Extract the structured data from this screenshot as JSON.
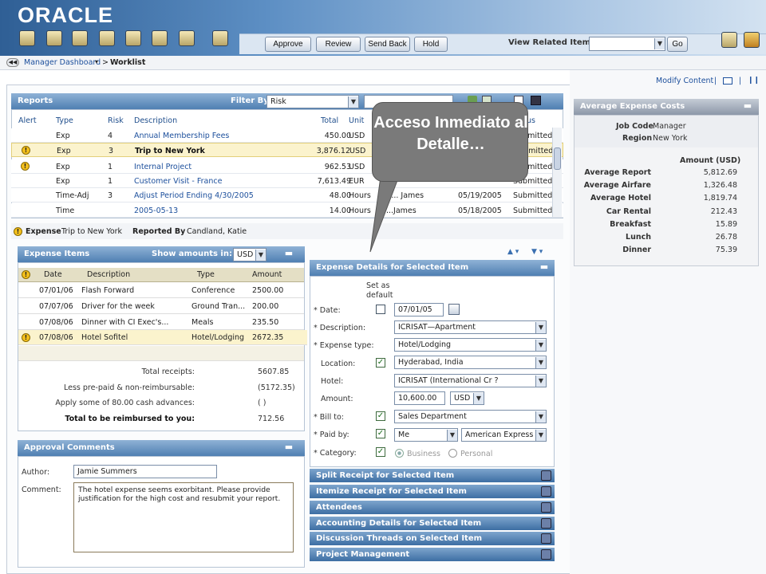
{
  "app": {
    "logo_text": "ORACLE"
  },
  "toolbar": {
    "icons": [
      "reports-icon",
      "search-icon",
      "expense-icon",
      "document-icon",
      "attach-icon",
      "user-icon",
      "chat-icon",
      "folder-icon"
    ],
    "approve_label": "Approve",
    "review_label": "Review",
    "sendback_label": "Send Back",
    "hold_label": "Hold",
    "view_related_label": "View Related Items",
    "view_related_value": "",
    "go_label": "Go",
    "right_icons": [
      "home-icon",
      "edit-icon"
    ]
  },
  "breadcrumb": {
    "dashboard": "Manager Dashboard",
    "separator": ">",
    "current": "Worklist"
  },
  "top_links": {
    "modify_content": "Modify Content",
    "sep": "|"
  },
  "reports": {
    "title": "Reports",
    "filter_label": "Filter By",
    "filter_value": "Risk",
    "columns": [
      "Alert",
      "Type",
      "Risk",
      "Description",
      "Total",
      "Unit",
      "",
      "",
      "us"
    ],
    "rows": [
      {
        "alert": false,
        "type": "Exp",
        "risk": "4",
        "description": "Annual Membership Fees",
        "total": "450.00",
        "unit": "USD",
        "submitter": "",
        "date": "",
        "status": "Submitted",
        "bold": false
      },
      {
        "alert": true,
        "type": "Exp",
        "risk": "3",
        "description": "Trip to New York",
        "total": "3,876.12",
        "unit": "USD",
        "submitter": "",
        "date": "",
        "status": "Submitted",
        "bold": true
      },
      {
        "alert": true,
        "type": "Exp",
        "risk": "1",
        "description": "Internal Project",
        "total": "962.53",
        "unit": "USD",
        "submitter": "",
        "date": "",
        "status": "Submitted",
        "bold": false
      },
      {
        "alert": false,
        "type": "Exp",
        "risk": "1",
        "description": "Customer Visit - France",
        "total": "7,613.49",
        "unit": "EUR",
        "submitter": "",
        "date": "",
        "status": "Submitted",
        "bold": false
      },
      {
        "alert": false,
        "type": "Time-Adj",
        "risk": "3",
        "description": "Adjust Period Ending 4/30/2005",
        "total": "48.00",
        "unit": "Hours",
        "submitter": "A... James",
        "date": "05/19/2005",
        "status": "Submitted",
        "bold": false
      },
      {
        "alert": false,
        "type": "Time",
        "risk": "",
        "description": "2005-05-13",
        "total": "14.00",
        "unit": "Hours",
        "submitter": "...James",
        "date": "05/18/2005",
        "status": "Submitted",
        "bold": false
      }
    ]
  },
  "selection": {
    "expense_label": "Expense",
    "expense_value": "Trip to New York",
    "reported_by_label": "Reported By",
    "reported_by_value": "Candland, Katie"
  },
  "expense_items": {
    "title": "Expense Items",
    "show_amounts_label": "Show amounts in:",
    "currency": "USD",
    "columns": [
      "Date",
      "Description",
      "Type",
      "Amount"
    ],
    "rows": [
      {
        "alert": false,
        "date": "07/01/06",
        "description": "Flash Forward",
        "type": "Conference",
        "amount": "2500.00"
      },
      {
        "alert": false,
        "date": "07/07/06",
        "description": "Driver for the week",
        "type": "Ground Tran...",
        "amount": "200.00"
      },
      {
        "alert": false,
        "date": "07/08/06",
        "description": "Dinner with CI Exec's...",
        "type": "Meals",
        "amount": "235.50"
      },
      {
        "alert": true,
        "date": "07/08/06",
        "description": "Hotel Sofitel",
        "type": "Hotel/Lodging",
        "amount": "2672.35"
      }
    ],
    "totals": [
      {
        "label": "Total receipts:",
        "value": "5607.85",
        "bold": false
      },
      {
        "label": "Less pre-paid & non-reimbursable:",
        "value": "(5172.35)",
        "bold": false
      },
      {
        "label": "Apply some of 80.00 cash advances:",
        "value": "(     )",
        "bold": false
      },
      {
        "label": "Total to be reimbursed to you:",
        "value": "712.56",
        "bold": true
      }
    ]
  },
  "approval": {
    "title": "Approval Comments",
    "author_label": "Author:",
    "author_value": "Jamie Summers",
    "comment_label": "Comment:",
    "comment_value": "The hotel expense seems exorbitant. Please provide justification for the high cost and resubmit your report."
  },
  "details": {
    "title": "Expense Details for Selected Item",
    "set_default_label": "Set as default",
    "fields": {
      "date_label": "* Date:",
      "date_value": "07/01/05",
      "description_label": "* Description:",
      "description_value": "ICRISAT—Apartment",
      "type_label": "* Expense type:",
      "type_value": "Hotel/Lodging",
      "location_label": "Location:",
      "location_value": "Hyderabad, India",
      "hotel_label": "Hotel:",
      "hotel_value": "ICRISAT (International Cr  ?",
      "amount_label": "Amount:",
      "amount_value": "10,600.00",
      "amount_currency": "USD",
      "billto_label": "* Bill to:",
      "billto_value": "Sales Department",
      "paidby_label": "* Paid by:",
      "paidby_value": "Me",
      "paidby_card": "American Express",
      "category_label": "* Category:",
      "category_business": "Business",
      "category_personal": "Personal"
    }
  },
  "accordions": [
    "Split Receipt for Selected Item",
    "Itemize Receipt for Selected Item",
    "Attendees",
    "Accounting Details for Selected  Item",
    "Discussion Threads on Selected Item",
    "Project Management"
  ],
  "avg_costs": {
    "title": "Average Expense Costs",
    "job_code_label": "Job Code",
    "job_code_value": "Manager",
    "region_label": "Region",
    "region_value": "New York",
    "amount_header": "Amount (USD)",
    "rows": [
      {
        "label": "Average Report",
        "value": "5,812.69"
      },
      {
        "label": "Average Airfare",
        "value": "1,326.48"
      },
      {
        "label": "Average Hotel",
        "value": "1,819.74"
      },
      {
        "label": "Car Rental",
        "value": "212.43"
      },
      {
        "label": "Breakfast",
        "value": "15.89"
      },
      {
        "label": "Lunch",
        "value": "26.78"
      },
      {
        "label": "Dinner",
        "value": "75.39"
      }
    ]
  },
  "callout": {
    "text": "Acceso Inmediato al Detalle…"
  }
}
